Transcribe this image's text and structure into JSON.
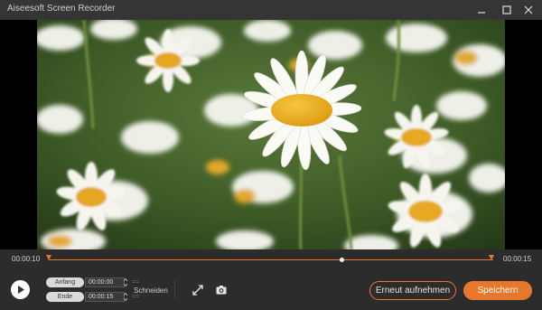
{
  "window": {
    "title": "Aiseesoft Screen Recorder",
    "controls": [
      "minimize-icon",
      "maximize-icon",
      "close-icon"
    ]
  },
  "timeline": {
    "start_time": "00:00:10",
    "end_time": "00:00:15",
    "playhead_fraction": 0.66
  },
  "trim": {
    "start_label": "Anfang",
    "start_value": "00:00:00",
    "end_label": "Ende",
    "end_value": "00:00:15",
    "cut_label": "Schneiden"
  },
  "actions": {
    "rerecord_label": "Erneut aufnehmen",
    "save_label": "Speichern"
  },
  "colors": {
    "accent": "#e8772e",
    "background": "#2b2b2b"
  },
  "icons": {
    "play": "play-icon",
    "expand": "expand-icon",
    "snapshot": "camera-icon"
  }
}
